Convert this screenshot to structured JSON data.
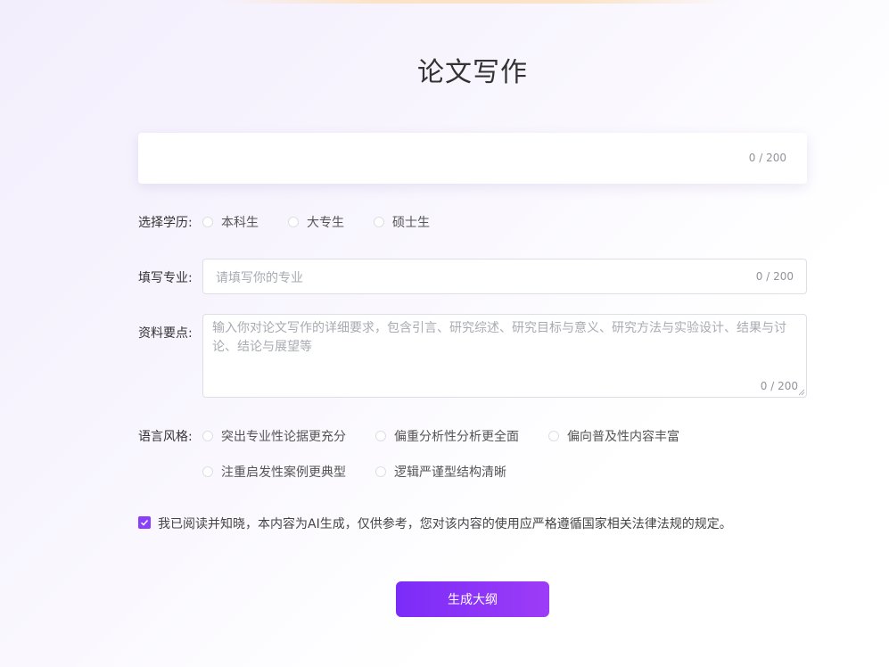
{
  "page": {
    "title": "论文写作"
  },
  "topic": {
    "value": "",
    "counter": "0 / 200"
  },
  "education": {
    "label": "选择学历:",
    "options": [
      "本科生",
      "大专生",
      "硕士生"
    ]
  },
  "major": {
    "label": "填写专业:",
    "placeholder": "请填写你的专业",
    "counter": "0 / 200"
  },
  "materials": {
    "label": "资料要点:",
    "placeholder_line1": "输入你对论文写作的详细要求，包含引言、研究综述、研究目标与意义、研究方法与实验设计、结果与讨",
    "placeholder_line2": "论、结论与展望等",
    "counter": "0 / 200"
  },
  "style": {
    "label": "语言风格:",
    "options": [
      "突出专业性论据更充分",
      "偏重分析性分析更全面",
      "偏向普及性内容丰富",
      "注重启发性案例更典型",
      "逻辑严谨型结构清晰"
    ]
  },
  "agreement": {
    "checked": true,
    "text": "我已阅读并知晓，本内容为AI生成，仅供参考，您对该内容的使用应严格遵循国家相关法律法规的规定。"
  },
  "actions": {
    "generate_label": "生成大纲"
  },
  "colors": {
    "accent": "#8a3ffc",
    "button_start": "#7b2cf8",
    "button_end": "#9d3cf7"
  }
}
